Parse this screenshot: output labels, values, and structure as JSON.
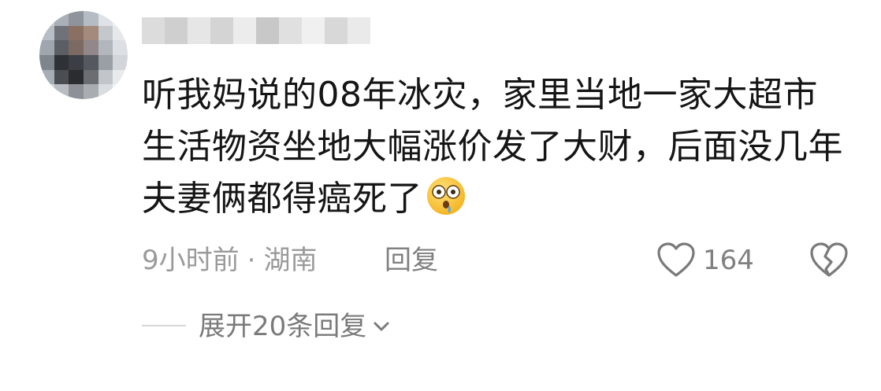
{
  "comment": {
    "lines": [
      "听我妈说的08年冰灾，家里当地一家大超市",
      "生活物资坐地大幅涨价发了大财，后面没几年",
      "夫妻俩都得癌死了"
    ],
    "emoji": "shocked-face-emoji"
  },
  "meta": {
    "time": "9小时前",
    "separator": "·",
    "location": "湖南",
    "reply_label": "回复"
  },
  "likes": {
    "count": "164",
    "icon": "heart-icon"
  },
  "dislike": {
    "icon": "broken-heart-icon"
  },
  "replies": {
    "expand_label": "展开20条回复",
    "icon": "chevron-down-icon"
  },
  "colors": {
    "text_primary": "#151515",
    "text_secondary": "#9a9a9a",
    "icon_gray": "#7a7a7a",
    "divider": "#d6d6d6",
    "background": "#ffffff"
  }
}
